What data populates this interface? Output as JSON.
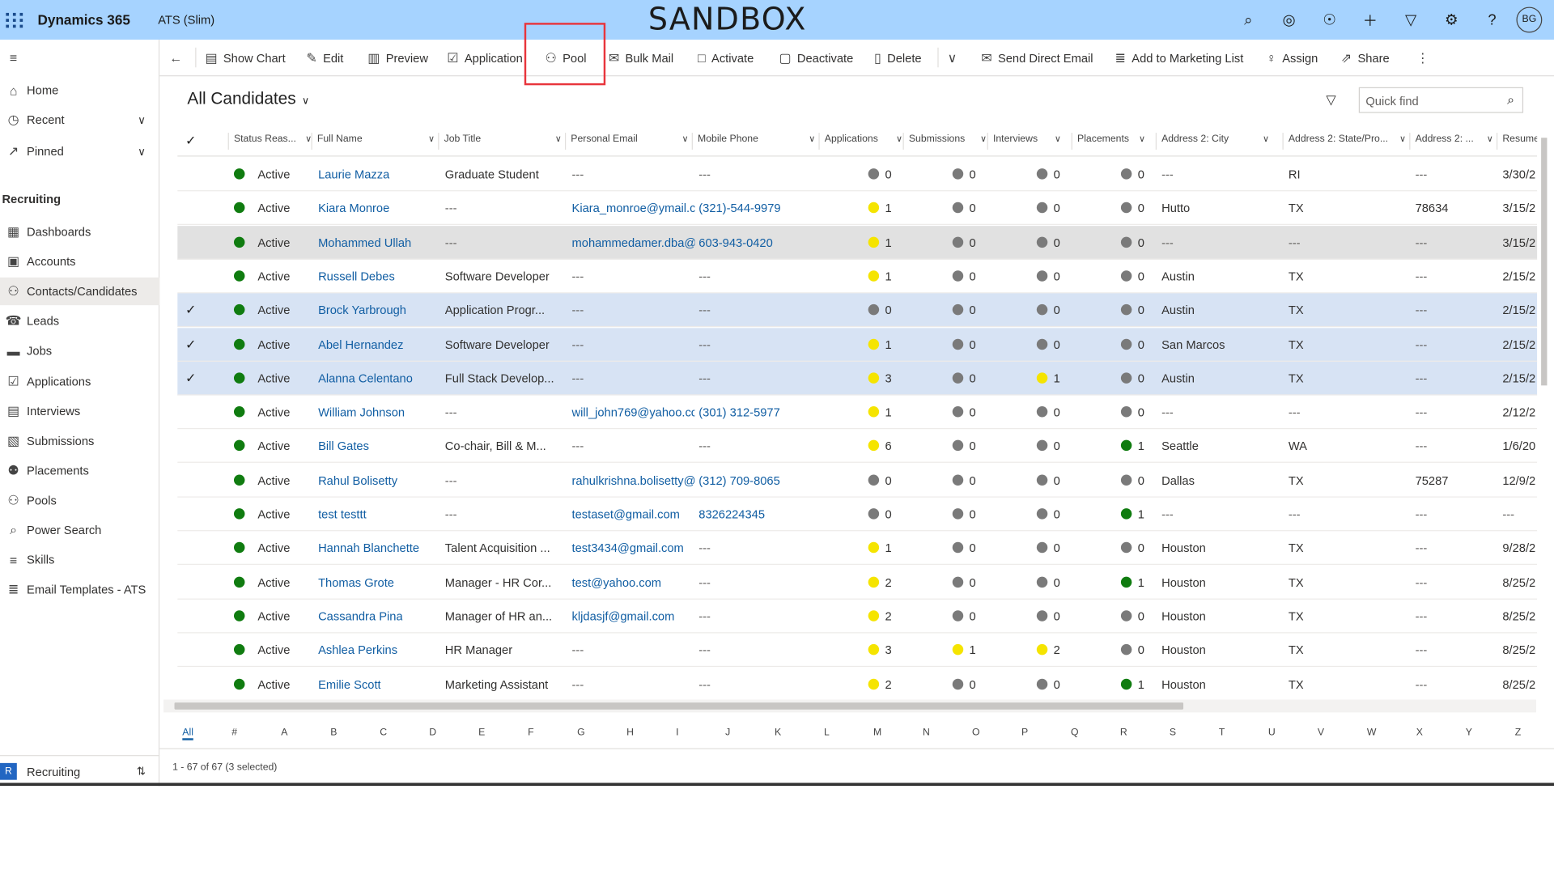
{
  "topbar": {
    "brand": "Dynamics 365",
    "app_name": "ATS (Slim)",
    "environment": "SANDBOX",
    "user_initials": "BG",
    "bg_color": "#a6d3ff"
  },
  "sidebar": {
    "items": [
      {
        "label": "Home",
        "icon": "home-icon"
      },
      {
        "label": "Recent",
        "icon": "clock-icon"
      },
      {
        "label": "Pinned",
        "icon": "pin-icon"
      }
    ],
    "section_title": "Recruiting",
    "section_items": [
      {
        "label": "Dashboards",
        "icon": "dashboard-icon"
      },
      {
        "label": "Accounts",
        "icon": "accounts-icon"
      },
      {
        "label": "Contacts/Candidates",
        "icon": "contacts-icon",
        "selected": true
      },
      {
        "label": "Leads",
        "icon": "leads-icon"
      },
      {
        "label": "Jobs",
        "icon": "briefcase-icon"
      },
      {
        "label": "Applications",
        "icon": "applications-icon"
      },
      {
        "label": "Interviews",
        "icon": "calendar-icon"
      },
      {
        "label": "Submissions",
        "icon": "submissions-icon"
      },
      {
        "label": "Placements",
        "icon": "placements-icon"
      },
      {
        "label": "Pools",
        "icon": "pools-icon"
      },
      {
        "label": "Power Search",
        "icon": "search-icon"
      },
      {
        "label": "Skills",
        "icon": "skills-icon"
      },
      {
        "label": "Email Templates - ATS",
        "icon": "email-templates-icon"
      }
    ],
    "area_badge": "R",
    "area_label": "Recruiting"
  },
  "toolbar": {
    "show_chart": "Show Chart",
    "edit": "Edit",
    "preview": "Preview",
    "application": "Application",
    "pool": "Pool",
    "bulk_mail": "Bulk Mail",
    "activate": "Activate",
    "deactivate": "Deactivate",
    "delete": "Delete",
    "send_direct_email": "Send Direct Email",
    "add_to_marketing_list": "Add to Marketing List",
    "assign": "Assign",
    "share": "Share"
  },
  "view": {
    "title": "All Candidates",
    "quick_find_placeholder": "Quick find"
  },
  "columns": [
    "Status Reas...",
    "Full Name",
    "Job Title",
    "Personal Email",
    "Mobile Phone",
    "Applications",
    "Submissions",
    "Interviews",
    "Placements",
    "Address 2: City",
    "Address 2: State/Pro...",
    "Address 2: ...",
    "Resume"
  ],
  "rows": [
    {
      "status": "Active",
      "name": "Laurie Mazza",
      "job": "Graduate Student",
      "email": "---",
      "phone": "---",
      "apps": "0",
      "apps_c": "g",
      "subs": "0",
      "subs_c": "g",
      "ints": "0",
      "ints_c": "g",
      "plc": "0",
      "plc_c": "g",
      "city": "---",
      "state": "RI",
      "zip": "---",
      "resume": "3/30/2",
      "selected": false
    },
    {
      "status": "Active",
      "name": "Kiara Monroe",
      "job": "---",
      "email": "Kiara_monroe@ymail.c",
      "phone": "(321)-544-9979",
      "apps": "1",
      "apps_c": "y",
      "subs": "0",
      "subs_c": "g",
      "ints": "0",
      "ints_c": "g",
      "plc": "0",
      "plc_c": "g",
      "city": "Hutto",
      "state": "TX",
      "zip": "78634",
      "resume": "3/15/2",
      "selected": false
    },
    {
      "status": "Active",
      "name": "Mohammed Ullah",
      "job": "---",
      "email": "mohammedamer.dba@",
      "phone": "603-943-0420",
      "apps": "1",
      "apps_c": "y",
      "subs": "0",
      "subs_c": "g",
      "ints": "0",
      "ints_c": "g",
      "plc": "0",
      "plc_c": "g",
      "city": "---",
      "state": "---",
      "zip": "---",
      "resume": "3/15/2",
      "selected": false,
      "hover": true
    },
    {
      "status": "Active",
      "name": "Russell Debes",
      "job": "Software Developer",
      "email": "---",
      "phone": "---",
      "apps": "1",
      "apps_c": "y",
      "subs": "0",
      "subs_c": "g",
      "ints": "0",
      "ints_c": "g",
      "plc": "0",
      "plc_c": "g",
      "city": "Austin",
      "state": "TX",
      "zip": "---",
      "resume": "2/15/2",
      "selected": false
    },
    {
      "status": "Active",
      "name": "Brock Yarbrough",
      "job": "Application Progr...",
      "email": "---",
      "phone": "---",
      "apps": "0",
      "apps_c": "g",
      "subs": "0",
      "subs_c": "g",
      "ints": "0",
      "ints_c": "g",
      "plc": "0",
      "plc_c": "g",
      "city": "Austin",
      "state": "TX",
      "zip": "---",
      "resume": "2/15/2",
      "selected": true
    },
    {
      "status": "Active",
      "name": "Abel Hernandez",
      "job": "Software Developer",
      "email": "---",
      "phone": "---",
      "apps": "1",
      "apps_c": "y",
      "subs": "0",
      "subs_c": "g",
      "ints": "0",
      "ints_c": "g",
      "plc": "0",
      "plc_c": "g",
      "city": "San Marcos",
      "state": "TX",
      "zip": "---",
      "resume": "2/15/2",
      "selected": true
    },
    {
      "status": "Active",
      "name": "Alanna Celentano",
      "job": "Full Stack Develop...",
      "email": "---",
      "phone": "---",
      "apps": "3",
      "apps_c": "y",
      "subs": "0",
      "subs_c": "g",
      "ints": "1",
      "ints_c": "y",
      "plc": "0",
      "plc_c": "g",
      "city": "Austin",
      "state": "TX",
      "zip": "---",
      "resume": "2/15/2",
      "selected": true
    },
    {
      "status": "Active",
      "name": "William Johnson",
      "job": "---",
      "email": "will_john769@yahoo.cc",
      "phone": "(301) 312-5977",
      "apps": "1",
      "apps_c": "y",
      "subs": "0",
      "subs_c": "g",
      "ints": "0",
      "ints_c": "g",
      "plc": "0",
      "plc_c": "g",
      "city": "---",
      "state": "---",
      "zip": "---",
      "resume": "2/12/2",
      "selected": false
    },
    {
      "status": "Active",
      "name": "Bill Gates",
      "job": "Co-chair, Bill & M...",
      "email": "---",
      "phone": "---",
      "apps": "6",
      "apps_c": "y",
      "subs": "0",
      "subs_c": "g",
      "ints": "0",
      "ints_c": "g",
      "plc": "1",
      "plc_c": "gr",
      "city": "Seattle",
      "state": "WA",
      "zip": "---",
      "resume": "1/6/20",
      "selected": false
    },
    {
      "status": "Active",
      "name": "Rahul Bolisetty",
      "job": "---",
      "email": "rahulkrishna.bolisetty@",
      "phone": "(312) 709-8065",
      "apps": "0",
      "apps_c": "g",
      "subs": "0",
      "subs_c": "g",
      "ints": "0",
      "ints_c": "g",
      "plc": "0",
      "plc_c": "g",
      "city": "Dallas",
      "state": "TX",
      "zip": "75287",
      "resume": "12/9/2",
      "selected": false
    },
    {
      "status": "Active",
      "name": "test testtt",
      "job": "---",
      "email": "testaset@gmail.com",
      "phone": "8326224345",
      "apps": "0",
      "apps_c": "g",
      "subs": "0",
      "subs_c": "g",
      "ints": "0",
      "ints_c": "g",
      "plc": "1",
      "plc_c": "gr",
      "city": "---",
      "state": "---",
      "zip": "---",
      "resume": "---",
      "selected": false
    },
    {
      "status": "Active",
      "name": "Hannah Blanchette",
      "job": "Talent Acquisition ...",
      "email": "test3434@gmail.com",
      "phone": "---",
      "apps": "1",
      "apps_c": "y",
      "subs": "0",
      "subs_c": "g",
      "ints": "0",
      "ints_c": "g",
      "plc": "0",
      "plc_c": "g",
      "city": "Houston",
      "state": "TX",
      "zip": "---",
      "resume": "9/28/2",
      "selected": false
    },
    {
      "status": "Active",
      "name": "Thomas Grote",
      "job": "Manager - HR Cor...",
      "email": "test@yahoo.com",
      "phone": "---",
      "apps": "2",
      "apps_c": "y",
      "subs": "0",
      "subs_c": "g",
      "ints": "0",
      "ints_c": "g",
      "plc": "1",
      "plc_c": "gr",
      "city": "Houston",
      "state": "TX",
      "zip": "---",
      "resume": "8/25/2",
      "selected": false
    },
    {
      "status": "Active",
      "name": "Cassandra Pina",
      "job": "Manager of HR an...",
      "email": "kljdasjf@gmail.com",
      "phone": "---",
      "apps": "2",
      "apps_c": "y",
      "subs": "0",
      "subs_c": "g",
      "ints": "0",
      "ints_c": "g",
      "plc": "0",
      "plc_c": "g",
      "city": "Houston",
      "state": "TX",
      "zip": "---",
      "resume": "8/25/2",
      "selected": false
    },
    {
      "status": "Active",
      "name": "Ashlea Perkins",
      "job": "HR Manager",
      "email": "---",
      "phone": "---",
      "apps": "3",
      "apps_c": "y",
      "subs": "1",
      "subs_c": "y",
      "ints": "2",
      "ints_c": "y",
      "plc": "0",
      "plc_c": "g",
      "city": "Houston",
      "state": "TX",
      "zip": "---",
      "resume": "8/25/2",
      "selected": false
    },
    {
      "status": "Active",
      "name": "Emilie Scott",
      "job": "Marketing Assistant",
      "email": "---",
      "phone": "---",
      "apps": "2",
      "apps_c": "y",
      "subs": "0",
      "subs_c": "g",
      "ints": "0",
      "ints_c": "g",
      "plc": "1",
      "plc_c": "gr",
      "city": "Houston",
      "state": "TX",
      "zip": "---",
      "resume": "8/25/2",
      "selected": false
    }
  ],
  "alphabet": [
    "All",
    "#",
    "A",
    "B",
    "C",
    "D",
    "E",
    "F",
    "G",
    "H",
    "I",
    "J",
    "K",
    "L",
    "M",
    "N",
    "O",
    "P",
    "Q",
    "R",
    "S",
    "T",
    "U",
    "V",
    "W",
    "X",
    "Y",
    "Z"
  ],
  "footer": "1 - 67 of 67 (3 selected)"
}
